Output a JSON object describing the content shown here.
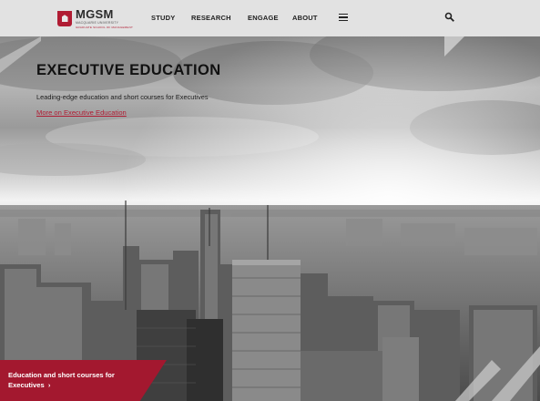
{
  "brand": {
    "name": "MGSM",
    "sub": "MACQUARIE UNIVERSITY",
    "sub2": "GRADUATE SCHOOL OF MANAGEMENT",
    "accent": "#b01c33"
  },
  "nav": {
    "items": [
      {
        "label": "STUDY"
      },
      {
        "label": "RESEARCH"
      },
      {
        "label": "ENGAGE"
      },
      {
        "label": "ABOUT"
      }
    ],
    "menu_icon": "hamburger-icon",
    "search_icon": "search-icon"
  },
  "hero": {
    "title": "EXECUTIVE EDUCATION",
    "subtitle": "Leading-edge education and short courses for Executives",
    "link": "More on Executive Education",
    "cta_line1": "Education and short courses for",
    "cta_line2": "Executives",
    "cta_arrow": "›"
  }
}
